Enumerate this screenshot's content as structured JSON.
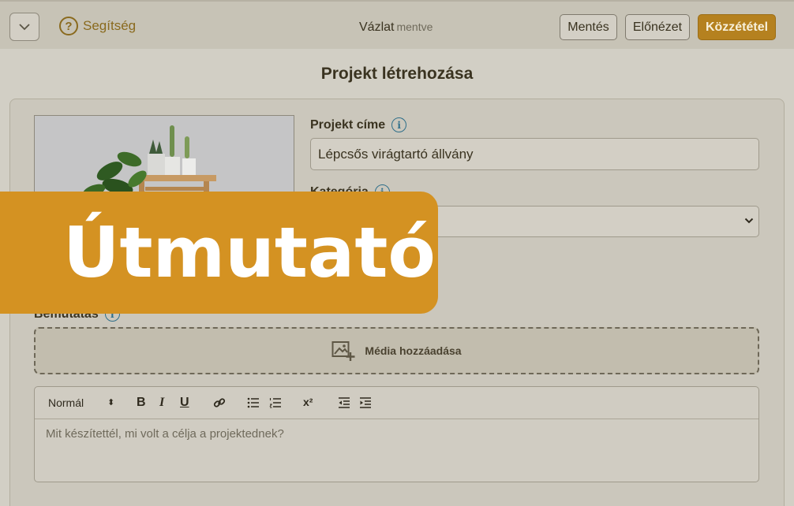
{
  "header": {
    "help_label": "Segítség",
    "draft_label": "Vázlat",
    "draft_status": "mentve",
    "save_label": "Mentés",
    "preview_label": "Előnézet",
    "publish_label": "Közzététel"
  },
  "page": {
    "title": "Projekt létrehozása"
  },
  "form": {
    "title_label": "Projekt címe",
    "title_value": "Lépcsős virágtartó állvány",
    "category_label": "Kategória",
    "category_value": "",
    "intro_label": "Bemutatás"
  },
  "media": {
    "add_label": "Média hozzáadása"
  },
  "editor": {
    "format_label": "Normál",
    "bold": "B",
    "italic": "I",
    "underline": "U",
    "superscript": "x²",
    "placeholder": "Mit készítettél, mi volt a célja a projektednek?"
  },
  "overlay": {
    "text": "Útmutató"
  },
  "colors": {
    "accent": "#b5811f",
    "banner": "#d49222",
    "info": "#2f6f8a"
  }
}
